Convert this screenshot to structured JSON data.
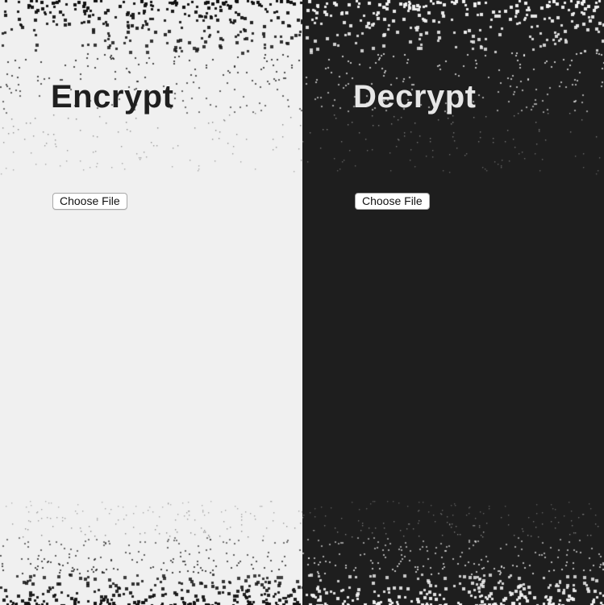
{
  "encrypt_panel": {
    "title": "Encrypt",
    "file_button_label": "Choose File",
    "background": "#f0f0f0",
    "dot_color": "#111111"
  },
  "decrypt_panel": {
    "title": "Decrypt",
    "file_button_label": "Choose File",
    "background": "#1e1e1e",
    "dot_color": "#f2f2f2"
  }
}
